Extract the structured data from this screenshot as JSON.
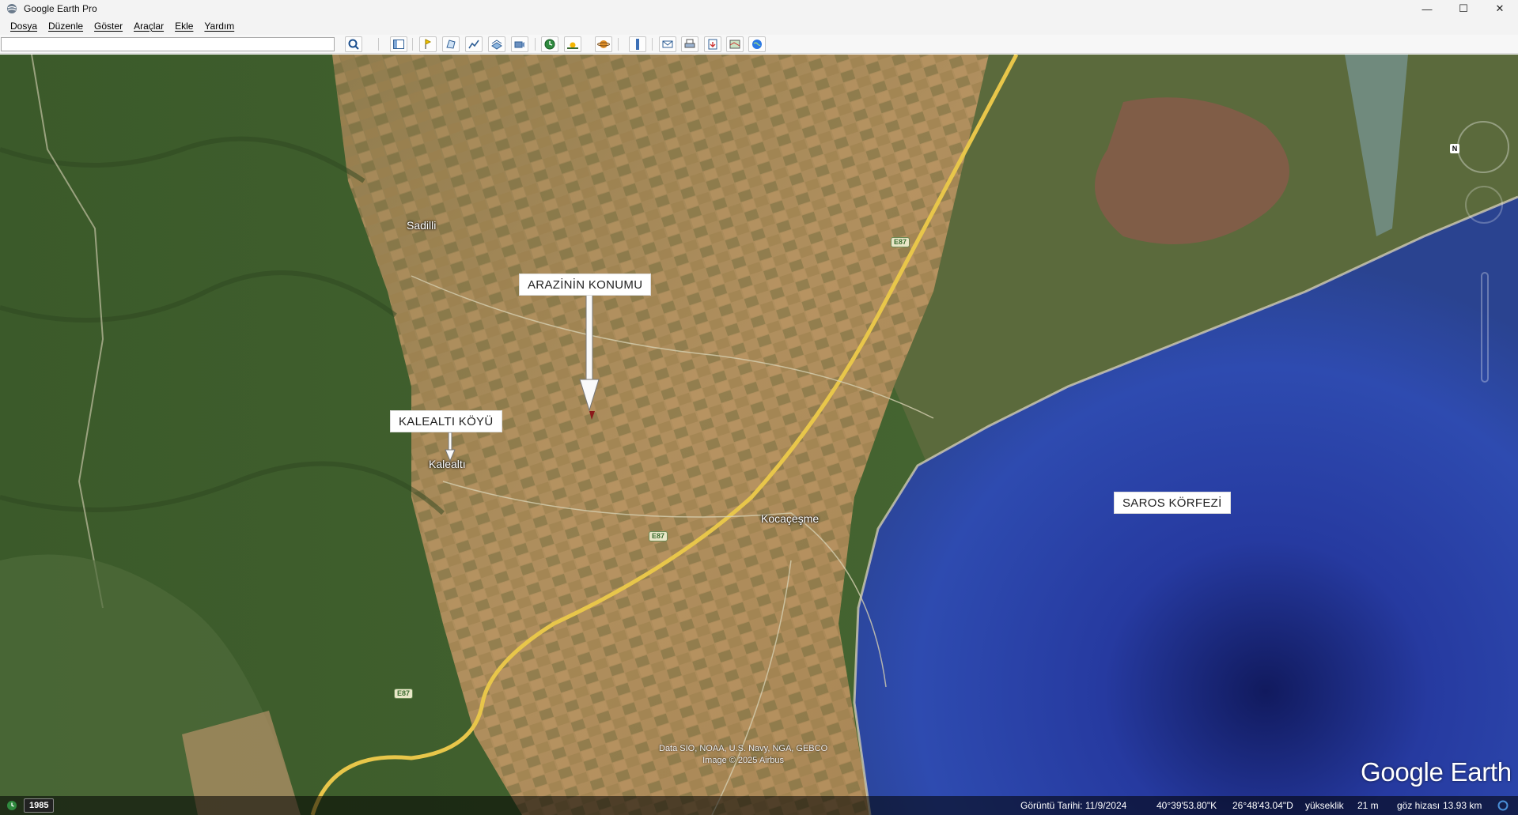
{
  "window": {
    "title": "Google Earth Pro",
    "controls": {
      "minimize": "—",
      "maximize": "☐",
      "close": "✕"
    }
  },
  "menu": {
    "items": [
      {
        "id": "file",
        "label": "Dosya"
      },
      {
        "id": "edit",
        "label": "Düzenle"
      },
      {
        "id": "view",
        "label": "Göster"
      },
      {
        "id": "tools",
        "label": "Araçlar"
      },
      {
        "id": "add",
        "label": "Ekle"
      },
      {
        "id": "help",
        "label": "Yardım"
      }
    ]
  },
  "toolbar": {
    "search_value": "",
    "buttons": [
      "search-icon",
      "sidebar-toggle-icon",
      "placemark-icon",
      "polygon-icon",
      "path-icon",
      "image-overlay-icon",
      "record-tour-icon",
      "historical-imagery-icon",
      "sunlight-icon",
      "planets-icon",
      "ruler-icon",
      "email-icon",
      "print-icon",
      "save-image-icon",
      "view-in-maps-icon",
      "earth-gallery-icon"
    ]
  },
  "map": {
    "annotations": {
      "land_location": "ARAZİNİN KONUMU",
      "village": "KALEALTI KÖYÜ",
      "gulf": "SAROS KÖRFEZİ"
    },
    "places": {
      "sadilli": "Sadilli",
      "kalealti": "Kalealtı",
      "kocacesme": "Kocaçeşme"
    },
    "road_shields": [
      "E87",
      "E87",
      "E87"
    ],
    "credits": {
      "line1": "Data SIO, NOAA, U.S. Navy, NGA, GEBCO",
      "line2": "Image © 2025 Airbus"
    },
    "logo": "Google Earth",
    "compass_north": "N"
  },
  "status": {
    "year": "1985",
    "imagery_date": "Görüntü Tarihi: 11/9/2024",
    "latitude": "40°39'53.80\"K",
    "longitude": "26°48'43.04\"D",
    "elevation_label": "yükseklik",
    "elevation_value": "21 m",
    "eye_alt_label": "göz hizası",
    "eye_alt_value": "13.93 km"
  },
  "colors": {
    "sea_deep": "#1e2c8a",
    "sea_mid": "#2f47a8",
    "farmland": "#a5865a",
    "forest": "#3e5a2c",
    "road": "#e8c64a"
  }
}
